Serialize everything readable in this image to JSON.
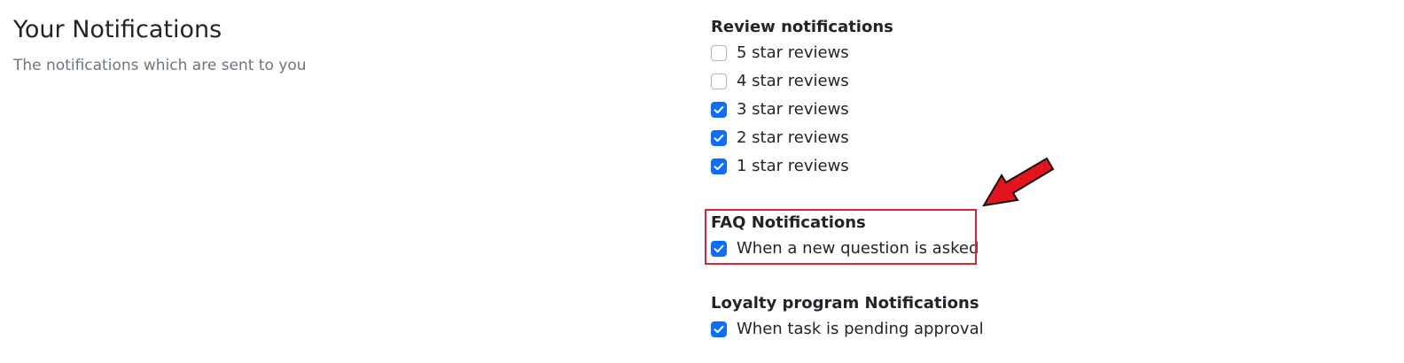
{
  "header": {
    "title": "Your Notifications",
    "subtitle": "The notifications which are sent to you"
  },
  "review": {
    "title": "Review notifications",
    "items": [
      {
        "label": "5 star reviews",
        "checked": false
      },
      {
        "label": "4 star reviews",
        "checked": false
      },
      {
        "label": "3 star reviews",
        "checked": true
      },
      {
        "label": "2 star reviews",
        "checked": true
      },
      {
        "label": "1 star reviews",
        "checked": true
      }
    ]
  },
  "faq": {
    "title": "FAQ Notifications",
    "items": [
      {
        "label": "When a new question is asked",
        "checked": true
      }
    ]
  },
  "loyalty": {
    "title": "Loyalty program Notifications",
    "items": [
      {
        "label": "When task is pending approval",
        "checked": true
      }
    ]
  },
  "annotation": {
    "highlight_color": "#d9262c",
    "arrow_color": "#e3141b",
    "arrow_icon": "arrow-pointing-down-left-icon"
  },
  "colors": {
    "accent": "#0d6efd",
    "muted_text": "#6c757d"
  }
}
